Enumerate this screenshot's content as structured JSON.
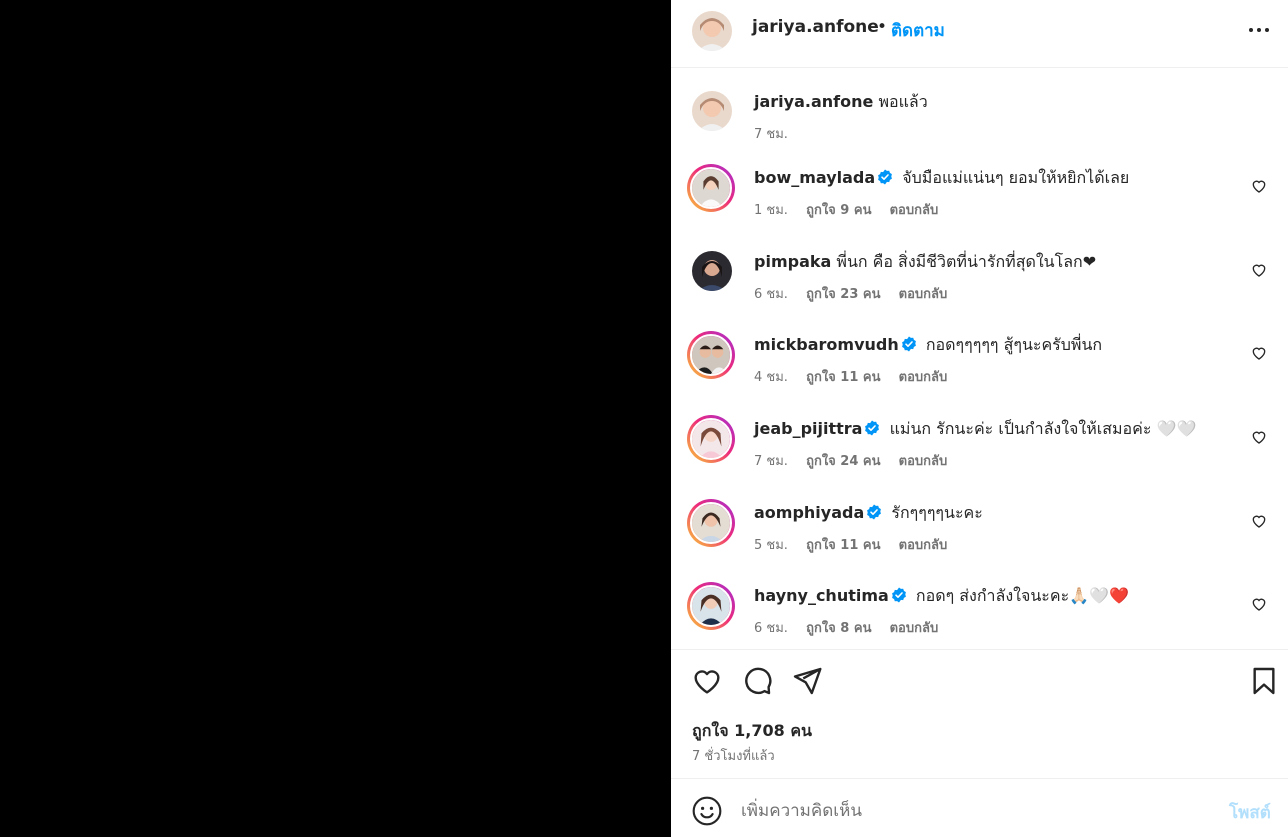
{
  "header": {
    "username": "jariya.anfone",
    "separator": "•",
    "follow_label": "ติดตาม"
  },
  "caption": {
    "username": "jariya.anfone",
    "text": "พอแล้ว",
    "time": "7 ชม."
  },
  "comments": [
    {
      "username": "bow_maylada",
      "verified": true,
      "text": "จับมือแม่แน่นๆ ยอมให้หยิกได้เลย",
      "time": "1 ชม.",
      "likes": "ถูกใจ 9 คน",
      "reply": "ตอบกลับ"
    },
    {
      "username": "pimpaka",
      "verified": false,
      "text": "พี่นก คือ สิ่งมีชีวิตที่น่ารักที่สุดในโลก❤",
      "time": "6 ชม.",
      "likes": "ถูกใจ 23 คน",
      "reply": "ตอบกลับ"
    },
    {
      "username": "mickbaromvudh",
      "verified": true,
      "text": "กอดๆๆๆๆๆ สู้ๆนะครับพี่นก",
      "time": "4 ชม.",
      "likes": "ถูกใจ 11 คน",
      "reply": "ตอบกลับ"
    },
    {
      "username": "jeab_pijittra",
      "verified": true,
      "text": "แม่นก รักนะค่ะ เป็นกำลังใจให้เสมอค่ะ 🤍🤍",
      "time": "7 ชม.",
      "likes": "ถูกใจ 24 คน",
      "reply": "ตอบกลับ"
    },
    {
      "username": "aomphiyada",
      "verified": true,
      "text": "รักๆๆๆๆนะคะ",
      "time": "5 ชม.",
      "likes": "ถูกใจ 11 คน",
      "reply": "ตอบกลับ"
    },
    {
      "username": "hayny_chutima",
      "verified": true,
      "text": "กอดๆ ส่งกำลังใจนะคะ🙏🏻🤍❤️",
      "time": "6 ชม.",
      "likes": "ถูกใจ 8 คน",
      "reply": "ตอบกลับ"
    }
  ],
  "post_stats": {
    "likes": "ถูกใจ 1,708 คน",
    "time_ago": "7 ชั่วโมงที่แล้ว"
  },
  "composer": {
    "placeholder": "เพิ่มความคิดเห็น",
    "post_label": "โพสต์"
  },
  "icons": {
    "more": "more-horizontal-icon",
    "like": "heart-icon",
    "comment": "comment-icon",
    "share": "send-icon",
    "save": "bookmark-icon",
    "emoji": "emoji-icon",
    "verified": "verified-badge-icon"
  },
  "colors": {
    "link_blue": "#0095f6",
    "post_disabled": "#b2dffc",
    "muted": "#737373",
    "verified": "#0095f6"
  }
}
